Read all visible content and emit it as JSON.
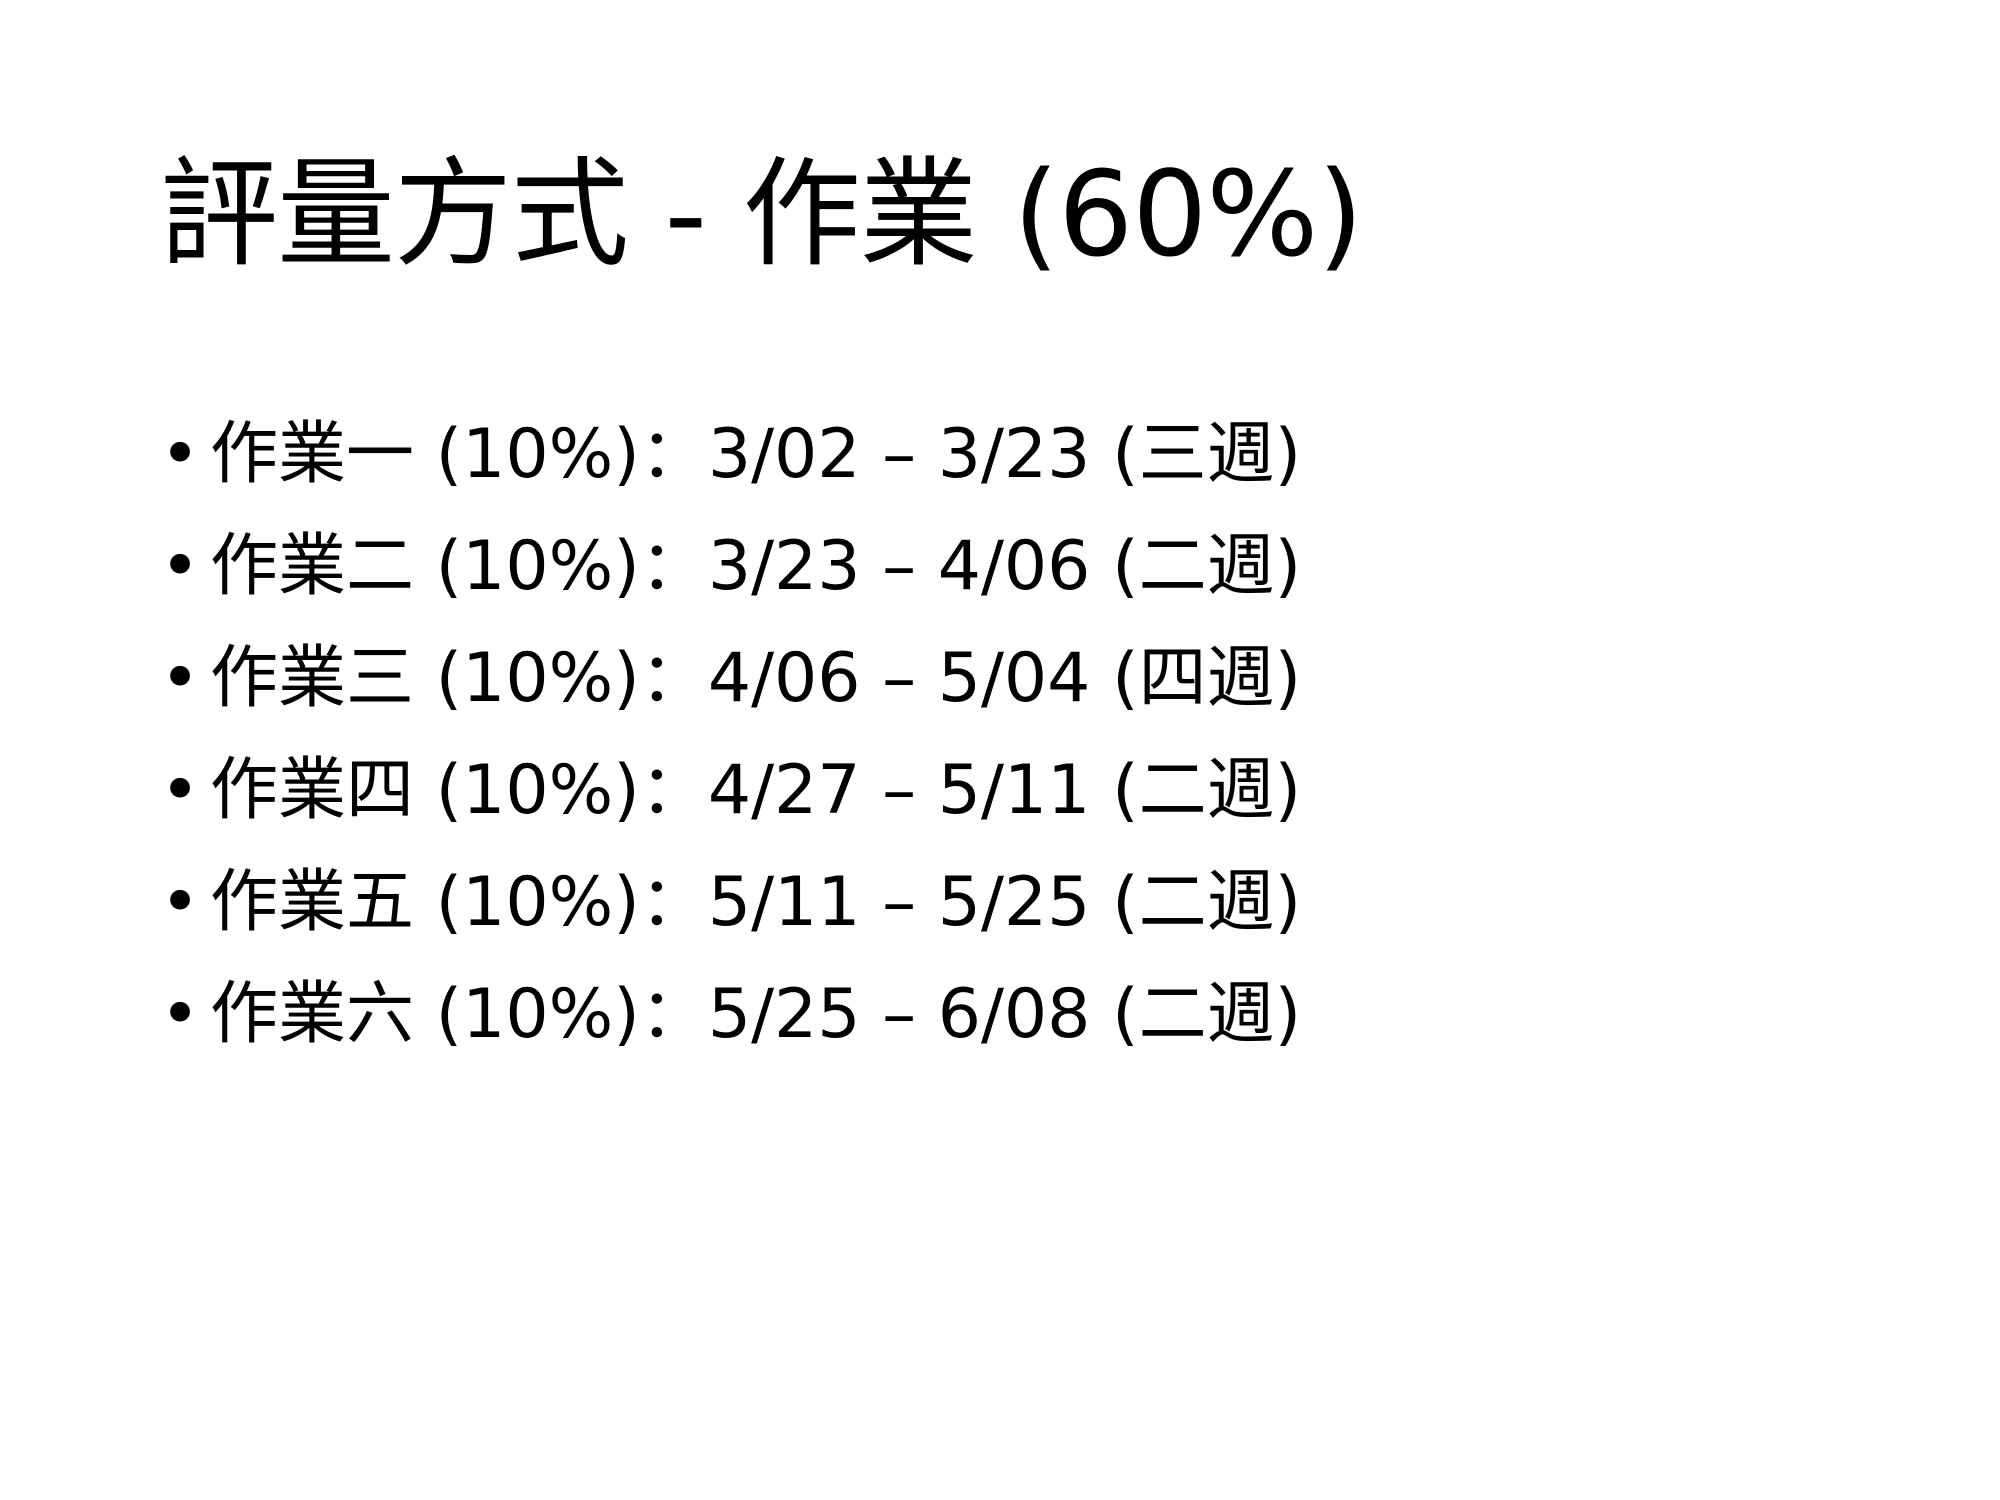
{
  "slide": {
    "title": "評量方式 - 作業 (60%)",
    "bullet_symbol": "•",
    "items": [
      {
        "text": "作業一 (10%)：3/02 – 3/23 (三週)"
      },
      {
        "text": "作業二 (10%)：3/23 – 4/06 (二週)"
      },
      {
        "text": "作業三 (10%)：4/06 – 5/04 (四週)"
      },
      {
        "text": "作業四 (10%)：4/27 – 5/11 (二週)"
      },
      {
        "text": "作業五 (10%)：5/11 – 5/25 (二週)"
      },
      {
        "text": "作業六 (10%)：5/25 – 6/08 (二週)"
      }
    ]
  }
}
